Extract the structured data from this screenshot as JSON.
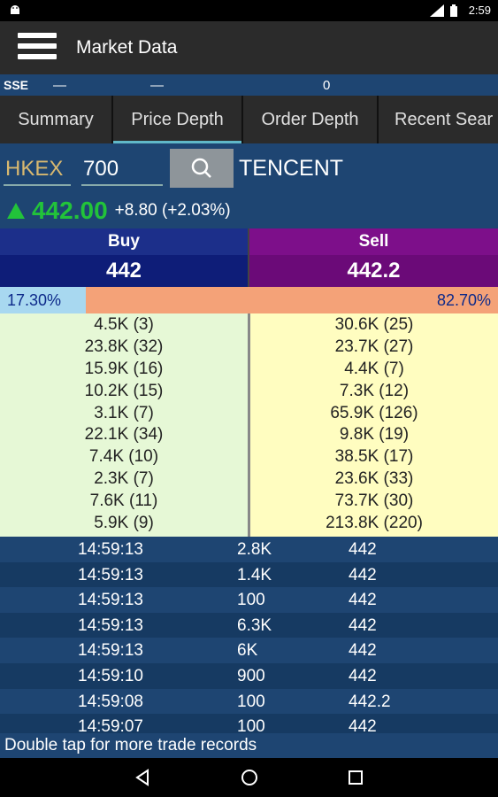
{
  "status_bar": {
    "time": "2:59",
    "notification_icon": "android-icon"
  },
  "app_bar": {
    "title": "Market Data",
    "menu_icon": "hamburger-menu-icon"
  },
  "index_bar": {
    "label": "SSE",
    "value1": "—",
    "value2": "—",
    "value3": "0"
  },
  "tabs": [
    {
      "label": "Summary",
      "active": false
    },
    {
      "label": "Price Depth",
      "active": true
    },
    {
      "label": "Order Depth",
      "active": false
    },
    {
      "label": "Recent Sear",
      "active": false
    }
  ],
  "search": {
    "exchange": "HKEX",
    "code": "700",
    "stock_name": "TENCENT"
  },
  "quote": {
    "last_price": "442.00",
    "change": "+8.80 (+2.03%)",
    "direction": "up",
    "up_color": "#22c33a"
  },
  "buy_sell": {
    "buy_label": "Buy",
    "sell_label": "Sell",
    "buy_price": "442",
    "sell_price": "442.2"
  },
  "ratio": {
    "buy_pct_text": "17.30%",
    "sell_pct_text": "82.70%",
    "buy_fraction": 0.173
  },
  "depth": {
    "buy": [
      "4.5K (3)",
      "23.8K (32)",
      "15.9K (16)",
      "10.2K (15)",
      "3.1K (7)",
      "22.1K (34)",
      "7.4K (10)",
      "2.3K (7)",
      "7.6K (11)",
      "5.9K (9)"
    ],
    "sell": [
      "30.6K (25)",
      "23.7K (27)",
      "4.4K (7)",
      "7.3K (12)",
      "65.9K (126)",
      "9.8K (19)",
      "38.5K (17)",
      "23.6K (33)",
      "73.7K (30)",
      "213.8K (220)"
    ]
  },
  "trades": [
    {
      "time": "14:59:13",
      "volume": "2.8K",
      "price": "442"
    },
    {
      "time": "14:59:13",
      "volume": "1.4K",
      "price": "442"
    },
    {
      "time": "14:59:13",
      "volume": "100",
      "price": "442"
    },
    {
      "time": "14:59:13",
      "volume": "6.3K",
      "price": "442"
    },
    {
      "time": "14:59:13",
      "volume": "6K",
      "price": "442"
    },
    {
      "time": "14:59:10",
      "volume": "900",
      "price": "442"
    },
    {
      "time": "14:59:08",
      "volume": "100",
      "price": "442.2"
    },
    {
      "time": "14:59:07",
      "volume": "100",
      "price": "442"
    }
  ],
  "hint": "Double tap for more trade records",
  "nav": {
    "back": "back-icon",
    "home": "home-icon",
    "recent": "recent-apps-icon"
  }
}
